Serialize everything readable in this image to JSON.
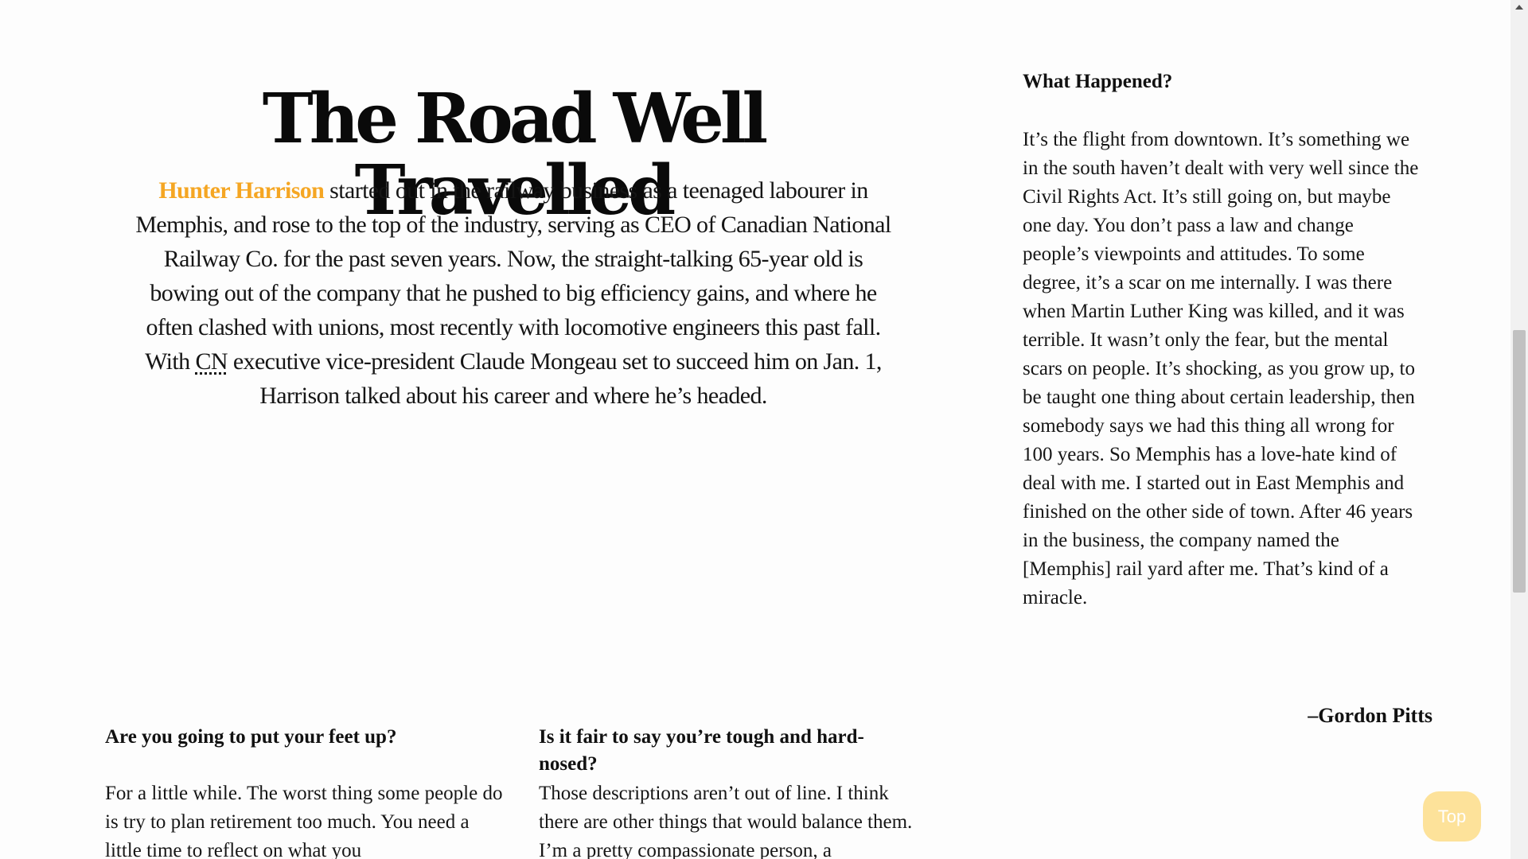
{
  "article": {
    "title": "The Road Well Travelled",
    "intro": {
      "name_link": "Hunter Harrison",
      "text_1": " started out in the railway business as a teenaged labourer in Memphis, and rose to the top of the industry, serving as CEO of Canadian National Railway Co. for the past seven years. Now, the straight-talking 65-year old is bowing out of the company that he pushed to big efficiency gains, and where he often clashed with unions, most recently with locomotive engineers this past fall. With ",
      "abbr": "CN",
      "text_2": " executive vice-president Claude Mongeau set to succeed him on Jan. 1, Harrison talked about his career and where he’s headed."
    }
  },
  "qa_right": {
    "question": "What Happened?",
    "answer": "It’s the flight from downtown. It’s something we in the south haven’t dealt with very well since the Civil Rights Act. It’s still going on, but maybe one day. You don’t pass a law and change people’s viewpoints and attitudes. To some degree, it’s a scar on me internally. I was there when Martin Luther King was killed, and it was terrible. It wasn’t only the fear, but the mental scars on people. It’s shocking, as you grow up, to be taught one thing about certain leadership, then somebody says we had this thing all wrong for 100 years. So Memphis has a love-hate kind of deal with me. I started out in East Memphis and finished on the other side of town. After 46 years in the business, the company named the [Memphis] rail yard after me. That’s kind of a miracle."
  },
  "qa_left": {
    "question": "Are you going to put your feet up?",
    "answer": "For a little while. The worst thing some people do is try to plan retirement too much. You need a little time to reflect on what you"
  },
  "qa_middle": {
    "question": "Is it fair to say you’re tough and hard-nosed?",
    "answer": "Those descriptions aren’t out of line. I think there are other things that would balance them. I’m a pretty compassionate person, a"
  },
  "signature": "–Gordon Pitts",
  "top_button": "Top",
  "colors": {
    "accent": "#f5a623",
    "top_button_bg": "#fde29a"
  }
}
